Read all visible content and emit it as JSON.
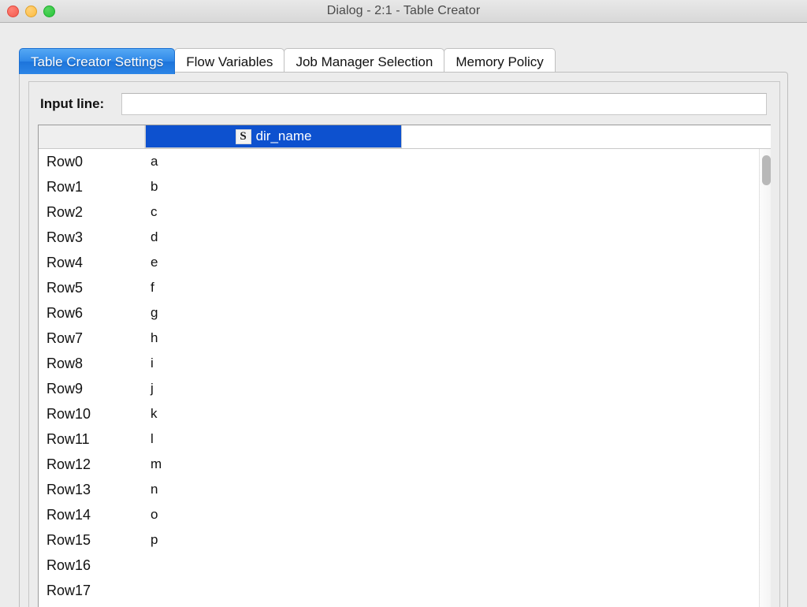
{
  "window": {
    "title": "Dialog - 2:1 - Table Creator",
    "traffic_lights": {
      "close": "close-button",
      "minimize": "minimize-button",
      "maximize": "maximize-button"
    }
  },
  "tabs": [
    {
      "label": "Table Creator Settings",
      "active": true
    },
    {
      "label": "Flow Variables",
      "active": false
    },
    {
      "label": "Job Manager Selection",
      "active": false
    },
    {
      "label": "Memory Policy",
      "active": false
    }
  ],
  "input_line": {
    "label": "Input line:",
    "value": "",
    "placeholder": ""
  },
  "table": {
    "corner_label": "",
    "columns": [
      {
        "name": "dir_name",
        "type_icon": "S",
        "type_icon_name": "string-type-icon",
        "selected": true
      }
    ],
    "rows": [
      {
        "label": "Row0",
        "dir_name": "a"
      },
      {
        "label": "Row1",
        "dir_name": "b"
      },
      {
        "label": "Row2",
        "dir_name": "c"
      },
      {
        "label": "Row3",
        "dir_name": "d"
      },
      {
        "label": "Row4",
        "dir_name": "e"
      },
      {
        "label": "Row5",
        "dir_name": "f"
      },
      {
        "label": "Row6",
        "dir_name": "g"
      },
      {
        "label": "Row7",
        "dir_name": "h"
      },
      {
        "label": "Row8",
        "dir_name": "i"
      },
      {
        "label": "Row9",
        "dir_name": "j"
      },
      {
        "label": "Row10",
        "dir_name": "k"
      },
      {
        "label": "Row11",
        "dir_name": "l"
      },
      {
        "label": "Row12",
        "dir_name": "m"
      },
      {
        "label": "Row13",
        "dir_name": "n"
      },
      {
        "label": "Row14",
        "dir_name": "o"
      },
      {
        "label": "Row15",
        "dir_name": "p"
      },
      {
        "label": "Row16",
        "dir_name": ""
      },
      {
        "label": "Row17",
        "dir_name": ""
      }
    ]
  },
  "colors": {
    "selection_blue": "#0d51cf",
    "active_tab_blue": "#2f88e8",
    "window_chrome": "#ececec",
    "close_red": "#f35b4f",
    "minimize_yellow": "#fcbb40",
    "maximize_green": "#27c43a"
  }
}
